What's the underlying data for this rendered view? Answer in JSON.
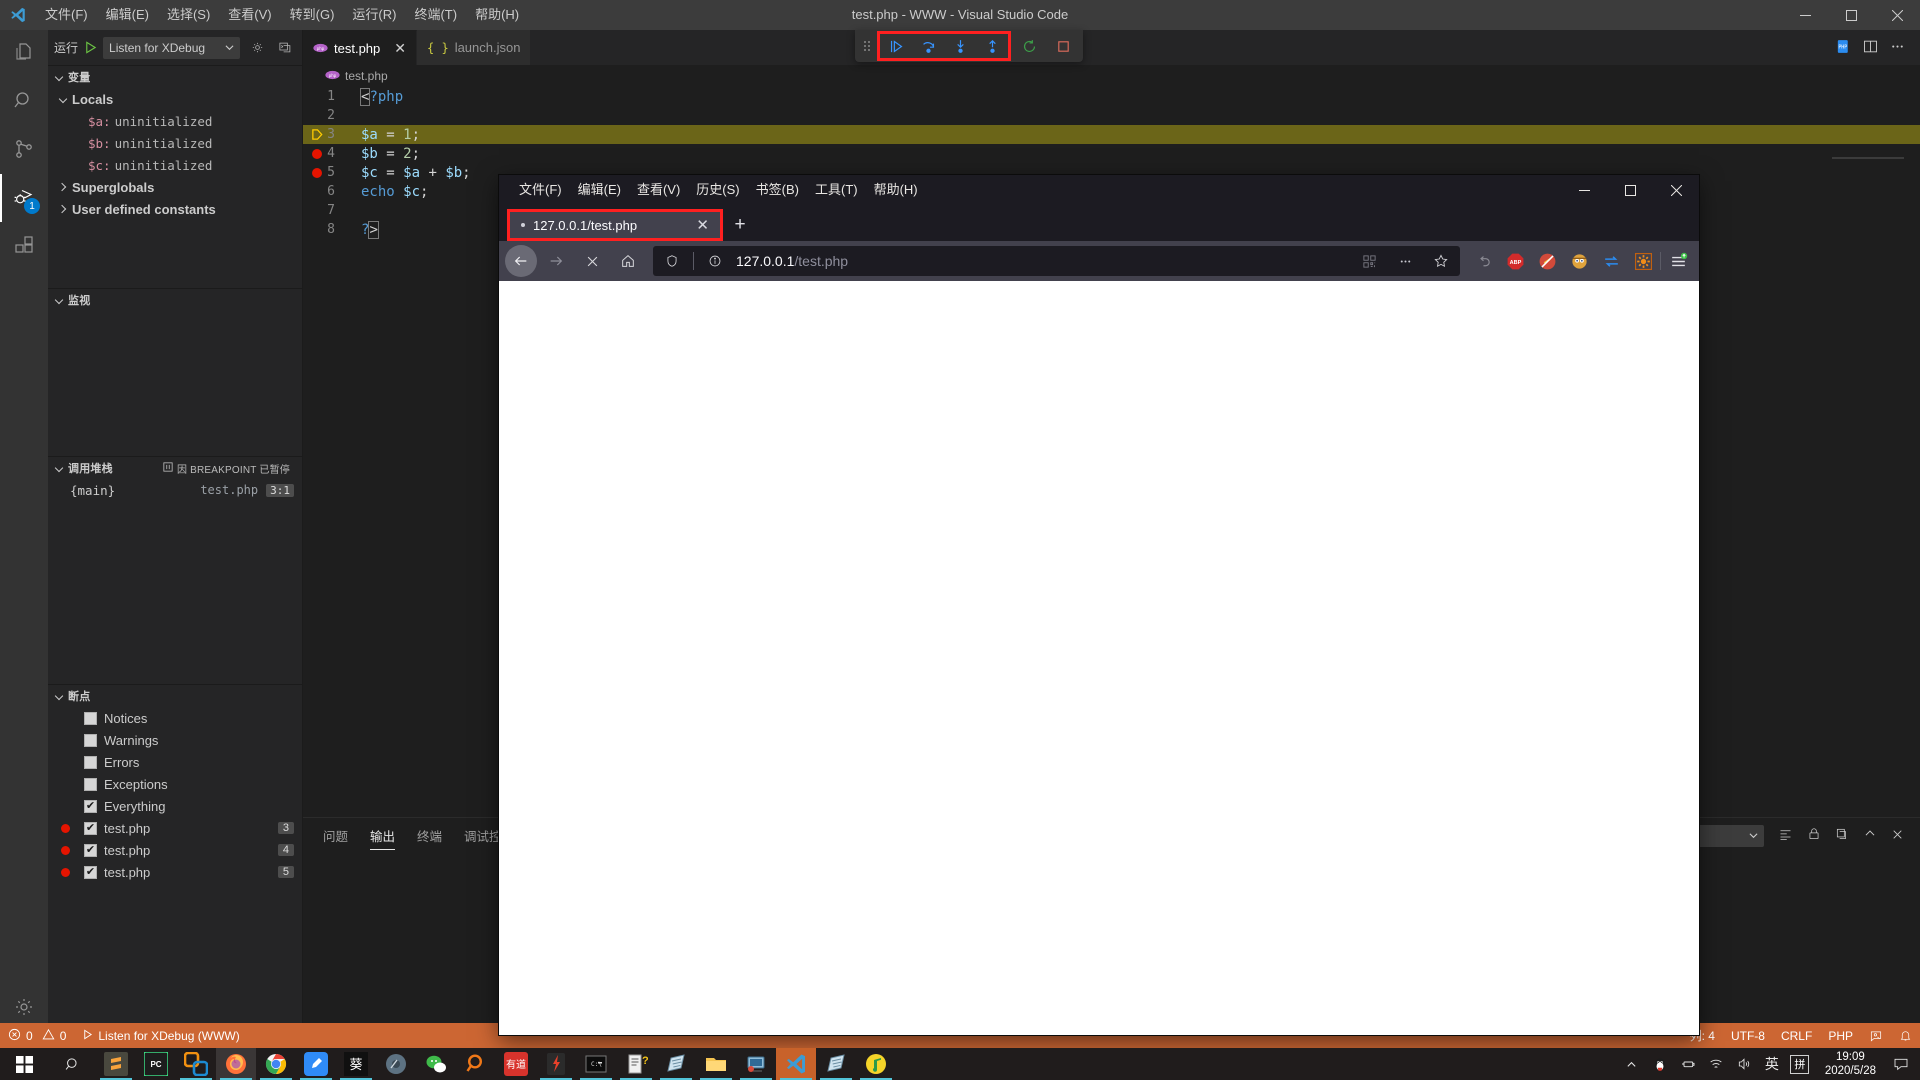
{
  "vscode": {
    "title": "test.php - WWW - Visual Studio Code",
    "menu": [
      "文件(F)",
      "编辑(E)",
      "选择(S)",
      "查看(V)",
      "转到(G)",
      "运行(R)",
      "终端(T)",
      "帮助(H)"
    ],
    "window_controls": {
      "minimize": "minimize-icon",
      "maximize": "maximize-icon",
      "close": "close-icon"
    },
    "activitybar": [
      {
        "name": "explorer",
        "icon": "files-icon",
        "badge": ""
      },
      {
        "name": "search",
        "icon": "search-icon",
        "badge": ""
      },
      {
        "name": "source-control",
        "icon": "source-control-icon",
        "badge": ""
      },
      {
        "name": "run-and-debug",
        "icon": "debug-icon",
        "badge": "1"
      },
      {
        "name": "extensions",
        "icon": "extensions-icon",
        "badge": ""
      },
      {
        "name": "manage",
        "icon": "gear-icon",
        "badge": ""
      }
    ],
    "debug_bar": {
      "run_label": "运行",
      "config_name": "Listen for XDebug",
      "start_icon": "play-icon",
      "settings_icon": "gear-icon",
      "open_debug_icon": "open-debug-console-icon"
    },
    "sections": {
      "variables": {
        "title": "变量",
        "groups": [
          {
            "label": "Locals",
            "expanded": true,
            "items": [
              {
                "name": "$a:",
                "value": "uninitialized"
              },
              {
                "name": "$b:",
                "value": "uninitialized"
              },
              {
                "name": "$c:",
                "value": "uninitialized"
              }
            ]
          },
          {
            "label": "Superglobals",
            "expanded": false,
            "items": []
          },
          {
            "label": "User defined constants",
            "expanded": false,
            "items": []
          }
        ]
      },
      "watch": {
        "title": "监视",
        "items": []
      },
      "callstack": {
        "title": "调用堆栈",
        "status": "因 BREAKPOINT 已暂停",
        "status_icon": "pause-icon",
        "frames": [
          {
            "name": "{main}",
            "file": "test.php",
            "line": "3:1"
          }
        ]
      },
      "breakpoints": {
        "title": "断点",
        "items": [
          {
            "checked": false,
            "label": "Notices",
            "line": ""
          },
          {
            "checked": false,
            "label": "Warnings",
            "line": ""
          },
          {
            "checked": false,
            "label": "Errors",
            "line": ""
          },
          {
            "checked": false,
            "label": "Exceptions",
            "line": ""
          },
          {
            "checked": true,
            "label": "Everything",
            "line": ""
          },
          {
            "checked": true,
            "label": "test.php",
            "line": "3",
            "dot": true
          },
          {
            "checked": true,
            "label": "test.php",
            "line": "4",
            "dot": true
          },
          {
            "checked": true,
            "label": "test.php",
            "line": "5",
            "dot": true
          }
        ]
      }
    },
    "tabs": [
      {
        "label": "test.php",
        "icon": "php-icon",
        "active": true,
        "close": "✕"
      },
      {
        "label": "launch.json",
        "icon": "json-icon",
        "active": false,
        "close": ""
      }
    ],
    "editor_actions": [
      "run-php-icon",
      "split-editor-icon",
      "more-actions-icon"
    ],
    "breadcrumb": {
      "icon": "php-icon",
      "text": "test.php"
    },
    "code": {
      "lines": [
        {
          "no": "1",
          "text": "<?php",
          "bp": false,
          "arrow": false,
          "hl": false
        },
        {
          "no": "2",
          "text": "",
          "bp": false,
          "arrow": false,
          "hl": false
        },
        {
          "no": "3",
          "text": "$a = 1;",
          "bp": false,
          "arrow": true,
          "hl": true
        },
        {
          "no": "4",
          "text": "$b = 2;",
          "bp": true,
          "arrow": false,
          "hl": false
        },
        {
          "no": "5",
          "text": "$c = $a + $b;",
          "bp": true,
          "arrow": false,
          "hl": false
        },
        {
          "no": "6",
          "text": "echo $c;",
          "bp": false,
          "arrow": false,
          "hl": false
        },
        {
          "no": "7",
          "text": "",
          "bp": false,
          "arrow": false,
          "hl": false
        },
        {
          "no": "8",
          "text": "?>",
          "bp": false,
          "arrow": false,
          "hl": false
        }
      ]
    },
    "panel": {
      "tabs": [
        {
          "label": "问题",
          "active": false
        },
        {
          "label": "输出",
          "active": true
        },
        {
          "label": "终端",
          "active": false
        },
        {
          "label": "调试控制台",
          "active": false
        }
      ],
      "source_select": "",
      "actions": [
        "clear-output-icon",
        "lock-icon",
        "new-terminal-icon",
        "maximize-panel-icon",
        "close-panel-icon"
      ]
    },
    "statusbar": {
      "errors_icon": "error-icon",
      "errors": "0",
      "warnings_icon": "warning-icon",
      "warnings": "0",
      "debug_icon": "play-icon",
      "debug_target": "Listen for XDebug (WWW)",
      "right": {
        "position": "列: 4",
        "encoding": "UTF-8",
        "eol": "CRLF",
        "language": "PHP",
        "feedback_icon": "feedback-icon",
        "bell_icon": "bell-icon"
      },
      "background": "#cc6633"
    }
  },
  "debug_toolbar": {
    "grip": "drag-handle-icon",
    "buttons": [
      {
        "name": "continue",
        "icon": "continue-icon",
        "highlighted": true
      },
      {
        "name": "step-over",
        "icon": "step-over-icon",
        "highlighted": true
      },
      {
        "name": "step-into",
        "icon": "step-into-icon",
        "highlighted": true
      },
      {
        "name": "step-out",
        "icon": "step-out-icon",
        "highlighted": true
      },
      {
        "name": "restart",
        "icon": "restart-icon",
        "highlighted": false
      },
      {
        "name": "stop",
        "icon": "stop-icon",
        "highlighted": false
      }
    ],
    "highlight_color": "#ff2020"
  },
  "firefox": {
    "menu": [
      "文件(F)",
      "编辑(E)",
      "查看(V)",
      "历史(S)",
      "书签(B)",
      "工具(T)",
      "帮助(H)"
    ],
    "window_controls": {
      "minimize": "minimize-icon",
      "maximize": "maximize-icon",
      "close": "close-icon"
    },
    "tab": {
      "title": "127.0.0.1/test.php",
      "close": "✕",
      "highlighted": true
    },
    "new_tab_label": "+",
    "nav": {
      "back_icon": "back-arrow-icon",
      "forward_icon": "forward-arrow-icon",
      "stop_icon": "stop-x-icon",
      "home_icon": "home-icon"
    },
    "urlbar": {
      "shield_icon": "shield-icon",
      "info_icon": "info-circle-icon",
      "host": "127.0.0.1",
      "path": "/test.php",
      "qr_icon": "qr-code-icon",
      "more_icon": "page-actions-icon",
      "bookmark_icon": "star-icon"
    },
    "extensions": [
      {
        "name": "undo-close-tab-icon",
        "color": "#8b8b94"
      },
      {
        "name": "adblock-plus-icon",
        "color": "#d32b2b"
      },
      {
        "name": "noscript-icon",
        "color": "#b83232"
      },
      {
        "name": "user-avatar-icon",
        "color": "#e0a33c"
      },
      {
        "name": "sync-swap-icon",
        "color": "#2b8cf0"
      },
      {
        "name": "gear-orange-icon",
        "color": "#e07b10"
      }
    ],
    "menu_button": "hamburger-menu-icon",
    "page_content": ""
  },
  "taskbar": {
    "start_icon": "windows-start-icon",
    "search_icon": "search-icon",
    "apps": [
      {
        "name": "sublime-text",
        "running": true
      },
      {
        "name": "phpstorm",
        "running": false
      },
      {
        "name": "teamviewer",
        "running": true
      },
      {
        "name": "firefox",
        "running": true,
        "focus": true
      },
      {
        "name": "chrome",
        "running": true
      },
      {
        "name": "editor-blue",
        "running": true
      },
      {
        "name": "kui-app",
        "running": true
      },
      {
        "name": "disk-tool",
        "running": false
      },
      {
        "name": "wechat",
        "running": false
      },
      {
        "name": "search-orange",
        "running": false
      },
      {
        "name": "youdao",
        "running": false
      },
      {
        "name": "flash-tool",
        "running": true
      },
      {
        "name": "cmd",
        "running": true
      },
      {
        "name": "help-doc",
        "running": true
      },
      {
        "name": "notepad",
        "running": true
      },
      {
        "name": "file-explorer",
        "running": true
      },
      {
        "name": "remote-desktop",
        "running": true
      },
      {
        "name": "visual-studio-code",
        "running": true,
        "active": true
      },
      {
        "name": "notepad-2",
        "running": true
      },
      {
        "name": "music-app",
        "running": true
      }
    ],
    "tray": {
      "expand_icon": "chevron-up-icon",
      "qq_icon": "qq-penguin-icon",
      "usb_icon": "usb-device-icon",
      "network_icon": "wifi-icon",
      "volume_icon": "speaker-icon",
      "ime_lang": "英",
      "ime_mode": "拼",
      "time": "19:09",
      "date": "2020/5/28",
      "notification_icon": "notification-icon"
    }
  }
}
